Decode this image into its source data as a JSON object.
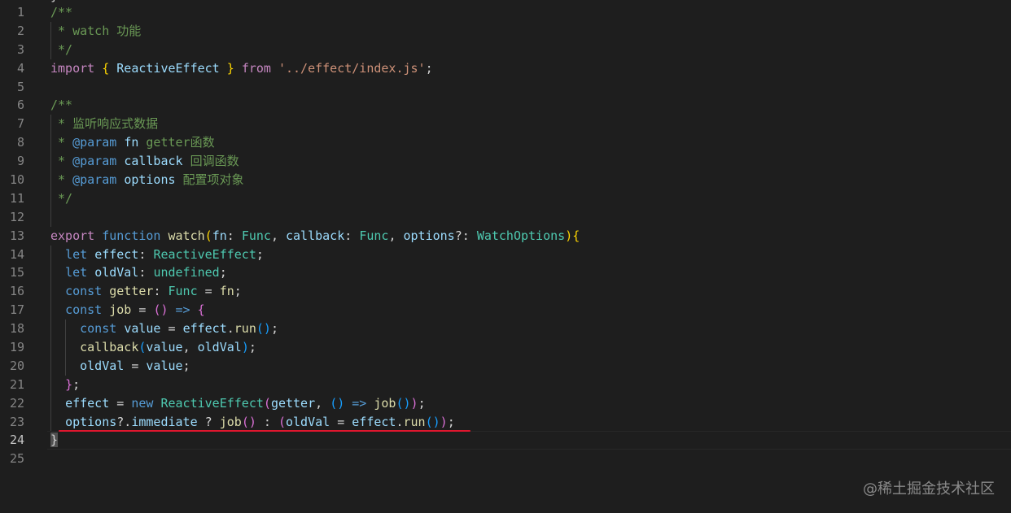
{
  "editor": {
    "top_fragment": "}",
    "lines": [
      {
        "n": "1",
        "tokens": [
          {
            "t": "/**",
            "c": "comment"
          }
        ]
      },
      {
        "n": "2",
        "tokens": [
          {
            "t": " * watch 功能",
            "c": "comment"
          }
        ]
      },
      {
        "n": "3",
        "tokens": [
          {
            "t": " */",
            "c": "comment"
          }
        ]
      },
      {
        "n": "4",
        "tokens": [
          {
            "t": "import",
            "c": "ctrl"
          },
          {
            "t": " ",
            "c": "op"
          },
          {
            "t": "{",
            "c": "p1"
          },
          {
            "t": " ",
            "c": "op"
          },
          {
            "t": "ReactiveEffect",
            "c": "var"
          },
          {
            "t": " ",
            "c": "op"
          },
          {
            "t": "}",
            "c": "p1"
          },
          {
            "t": " ",
            "c": "op"
          },
          {
            "t": "from",
            "c": "ctrl"
          },
          {
            "t": " ",
            "c": "op"
          },
          {
            "t": "'../effect/index.js'",
            "c": "str"
          },
          {
            "t": ";",
            "c": "op"
          }
        ]
      },
      {
        "n": "5",
        "tokens": []
      },
      {
        "n": "6",
        "tokens": [
          {
            "t": "/**",
            "c": "comment"
          }
        ]
      },
      {
        "n": "7",
        "tokens": [
          {
            "t": " * 监听响应式数据",
            "c": "comment"
          }
        ]
      },
      {
        "n": "8",
        "tokens": [
          {
            "t": " * ",
            "c": "comment"
          },
          {
            "t": "@param",
            "c": "tagkw"
          },
          {
            "t": " ",
            "c": "comment"
          },
          {
            "t": "fn",
            "c": "var"
          },
          {
            "t": " getter函数",
            "c": "comment"
          }
        ]
      },
      {
        "n": "9",
        "tokens": [
          {
            "t": " * ",
            "c": "comment"
          },
          {
            "t": "@param",
            "c": "tagkw"
          },
          {
            "t": " ",
            "c": "comment"
          },
          {
            "t": "callback",
            "c": "var"
          },
          {
            "t": " 回调函数",
            "c": "comment"
          }
        ]
      },
      {
        "n": "10",
        "tokens": [
          {
            "t": " * ",
            "c": "comment"
          },
          {
            "t": "@param",
            "c": "tagkw"
          },
          {
            "t": " ",
            "c": "comment"
          },
          {
            "t": "options",
            "c": "var"
          },
          {
            "t": " 配置项对象",
            "c": "comment"
          }
        ]
      },
      {
        "n": "11",
        "tokens": [
          {
            "t": " */",
            "c": "comment"
          }
        ]
      },
      {
        "n": "12",
        "tokens": []
      },
      {
        "n": "13",
        "tokens": [
          {
            "t": "export",
            "c": "ctrl"
          },
          {
            "t": " ",
            "c": "op"
          },
          {
            "t": "function",
            "c": "kw"
          },
          {
            "t": " ",
            "c": "op"
          },
          {
            "t": "watch",
            "c": "fn"
          },
          {
            "t": "(",
            "c": "p1"
          },
          {
            "t": "fn",
            "c": "var"
          },
          {
            "t": ": ",
            "c": "op"
          },
          {
            "t": "Func",
            "c": "type"
          },
          {
            "t": ", ",
            "c": "op"
          },
          {
            "t": "callback",
            "c": "var"
          },
          {
            "t": ": ",
            "c": "op"
          },
          {
            "t": "Func",
            "c": "type"
          },
          {
            "t": ", ",
            "c": "op"
          },
          {
            "t": "options",
            "c": "var"
          },
          {
            "t": "?: ",
            "c": "op"
          },
          {
            "t": "WatchOptions",
            "c": "type"
          },
          {
            "t": ")",
            "c": "p1"
          },
          {
            "t": "{",
            "c": "p1"
          }
        ]
      },
      {
        "n": "14",
        "tokens": [
          {
            "t": "  ",
            "c": "op"
          },
          {
            "t": "let",
            "c": "kw"
          },
          {
            "t": " ",
            "c": "op"
          },
          {
            "t": "effect",
            "c": "var"
          },
          {
            "t": ": ",
            "c": "op"
          },
          {
            "t": "ReactiveEffect",
            "c": "type"
          },
          {
            "t": ";",
            "c": "op"
          }
        ]
      },
      {
        "n": "15",
        "tokens": [
          {
            "t": "  ",
            "c": "op"
          },
          {
            "t": "let",
            "c": "kw"
          },
          {
            "t": " ",
            "c": "op"
          },
          {
            "t": "oldVal",
            "c": "var"
          },
          {
            "t": ": ",
            "c": "op"
          },
          {
            "t": "undefined",
            "c": "type"
          },
          {
            "t": ";",
            "c": "op"
          }
        ]
      },
      {
        "n": "16",
        "tokens": [
          {
            "t": "  ",
            "c": "op"
          },
          {
            "t": "const",
            "c": "kw"
          },
          {
            "t": " ",
            "c": "op"
          },
          {
            "t": "getter",
            "c": "fn"
          },
          {
            "t": ": ",
            "c": "op"
          },
          {
            "t": "Func",
            "c": "type"
          },
          {
            "t": " = ",
            "c": "op"
          },
          {
            "t": "fn",
            "c": "fn"
          },
          {
            "t": ";",
            "c": "op"
          }
        ]
      },
      {
        "n": "17",
        "tokens": [
          {
            "t": "  ",
            "c": "op"
          },
          {
            "t": "const",
            "c": "kw"
          },
          {
            "t": " ",
            "c": "op"
          },
          {
            "t": "job",
            "c": "fn"
          },
          {
            "t": " = ",
            "c": "op"
          },
          {
            "t": "()",
            "c": "p2"
          },
          {
            "t": " ",
            "c": "op"
          },
          {
            "t": "=>",
            "c": "kw"
          },
          {
            "t": " ",
            "c": "op"
          },
          {
            "t": "{",
            "c": "p2"
          }
        ]
      },
      {
        "n": "18",
        "tokens": [
          {
            "t": "    ",
            "c": "op"
          },
          {
            "t": "const",
            "c": "kw"
          },
          {
            "t": " ",
            "c": "op"
          },
          {
            "t": "value",
            "c": "var"
          },
          {
            "t": " = ",
            "c": "op"
          },
          {
            "t": "effect",
            "c": "var"
          },
          {
            "t": ".",
            "c": "op"
          },
          {
            "t": "run",
            "c": "fn"
          },
          {
            "t": "()",
            "c": "p3"
          },
          {
            "t": ";",
            "c": "op"
          }
        ]
      },
      {
        "n": "19",
        "tokens": [
          {
            "t": "    ",
            "c": "op"
          },
          {
            "t": "callback",
            "c": "fn"
          },
          {
            "t": "(",
            "c": "p3"
          },
          {
            "t": "value",
            "c": "var"
          },
          {
            "t": ", ",
            "c": "op"
          },
          {
            "t": "oldVal",
            "c": "var"
          },
          {
            "t": ")",
            "c": "p3"
          },
          {
            "t": ";",
            "c": "op"
          }
        ]
      },
      {
        "n": "20",
        "tokens": [
          {
            "t": "    ",
            "c": "op"
          },
          {
            "t": "oldVal",
            "c": "var"
          },
          {
            "t": " = ",
            "c": "op"
          },
          {
            "t": "value",
            "c": "var"
          },
          {
            "t": ";",
            "c": "op"
          }
        ]
      },
      {
        "n": "21",
        "tokens": [
          {
            "t": "  ",
            "c": "op"
          },
          {
            "t": "}",
            "c": "p2"
          },
          {
            "t": ";",
            "c": "op"
          }
        ]
      },
      {
        "n": "22",
        "tokens": [
          {
            "t": "  ",
            "c": "op"
          },
          {
            "t": "effect",
            "c": "var"
          },
          {
            "t": " = ",
            "c": "op"
          },
          {
            "t": "new",
            "c": "kw"
          },
          {
            "t": " ",
            "c": "op"
          },
          {
            "t": "ReactiveEffect",
            "c": "type"
          },
          {
            "t": "(",
            "c": "p2"
          },
          {
            "t": "getter",
            "c": "var"
          },
          {
            "t": ", ",
            "c": "op"
          },
          {
            "t": "()",
            "c": "p3"
          },
          {
            "t": " ",
            "c": "op"
          },
          {
            "t": "=>",
            "c": "kw"
          },
          {
            "t": " ",
            "c": "op"
          },
          {
            "t": "job",
            "c": "fn"
          },
          {
            "t": "()",
            "c": "p3"
          },
          {
            "t": ")",
            "c": "p2"
          },
          {
            "t": ";",
            "c": "op"
          }
        ]
      },
      {
        "n": "23",
        "tokens": [
          {
            "t": "  ",
            "c": "op"
          },
          {
            "t": "options",
            "c": "var"
          },
          {
            "t": "?.",
            "c": "op"
          },
          {
            "t": "immediate",
            "c": "var"
          },
          {
            "t": " ? ",
            "c": "op"
          },
          {
            "t": "job",
            "c": "fn"
          },
          {
            "t": "()",
            "c": "p2"
          },
          {
            "t": " : ",
            "c": "op"
          },
          {
            "t": "(",
            "c": "p2"
          },
          {
            "t": "oldVal",
            "c": "var"
          },
          {
            "t": " = ",
            "c": "op"
          },
          {
            "t": "effect",
            "c": "var"
          },
          {
            "t": ".",
            "c": "op"
          },
          {
            "t": "run",
            "c": "fn"
          },
          {
            "t": "()",
            "c": "p3"
          },
          {
            "t": ")",
            "c": "p2"
          },
          {
            "t": ";",
            "c": "op"
          }
        ]
      },
      {
        "n": "24",
        "current": true,
        "tokens": [
          {
            "t": "}",
            "c": "cursor"
          }
        ]
      },
      {
        "n": "25",
        "tokens": []
      }
    ]
  },
  "watermark": "@稀土掘金技术社区",
  "colors": {
    "background": "#1e1e1e",
    "annotation_underline": "#e0162e"
  }
}
